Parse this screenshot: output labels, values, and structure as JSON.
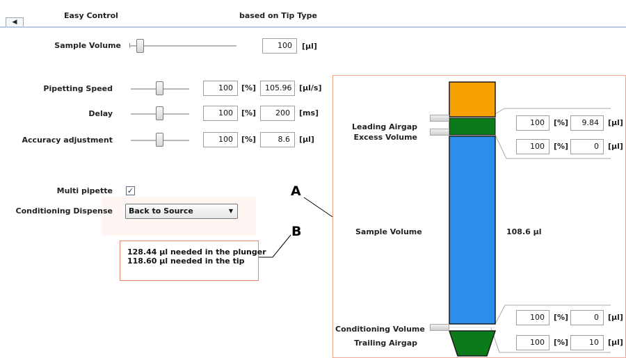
{
  "header": {
    "collapse_glyph": "◀",
    "left_title": "Easy Control",
    "right_title": "based on Tip Type"
  },
  "sample_volume": {
    "label": "Sample Volume",
    "value": "100",
    "unit": "[µl]",
    "slider_fraction": 0.05
  },
  "params": [
    {
      "label": "Pipetting Speed",
      "percent": "100",
      "percent_unit": "[%]",
      "value": "105.96",
      "value_unit": "[µl/s]",
      "slider_fraction": 0.5
    },
    {
      "label": "Delay",
      "percent": "100",
      "percent_unit": "[%]",
      "value": "200",
      "value_unit": "[ms]",
      "slider_fraction": 0.5
    },
    {
      "label": "Accuracy adjustment",
      "percent": "100",
      "percent_unit": "[%]",
      "value": "8.6",
      "value_unit": "[µl]",
      "slider_fraction": 0.5
    }
  ],
  "multi_pipette": {
    "label": "Multi pipette",
    "checked": true,
    "check_glyph": "✓"
  },
  "conditioning_dispense": {
    "label": "Conditioning Dispense",
    "selected": "Back to Source",
    "arrow_glyph": "▼"
  },
  "info_box": {
    "line1": "128.44 µl needed in the plunger",
    "line2": "118.60 µl needed in the tip"
  },
  "callouts": {
    "a": "A",
    "b": "B"
  },
  "tip": {
    "labels": {
      "leading_airgap": "Leading Airgap",
      "excess_volume": "Excess Volume",
      "sample_volume": "Sample Volume",
      "conditioning_volume": "Conditioning Volume",
      "trailing_airgap": "Trailing Airgap"
    },
    "sample_volume_value": "108.6 µl",
    "rows": [
      {
        "percent": "100",
        "percent_unit": "[%]",
        "value": "9.84",
        "value_unit": "[µl]"
      },
      {
        "percent": "100",
        "percent_unit": "[%]",
        "value": "0",
        "value_unit": "[µl]"
      },
      {
        "percent": "100",
        "percent_unit": "[%]",
        "value": "0",
        "value_unit": "[µl]"
      },
      {
        "percent": "100",
        "percent_unit": "[%]",
        "value": "10",
        "value_unit": "[µl]"
      }
    ],
    "colors": {
      "top": "#f7a100",
      "green": "#0a7a1a",
      "blue": "#2b8ee8",
      "outline": "#1a1a1a"
    }
  }
}
